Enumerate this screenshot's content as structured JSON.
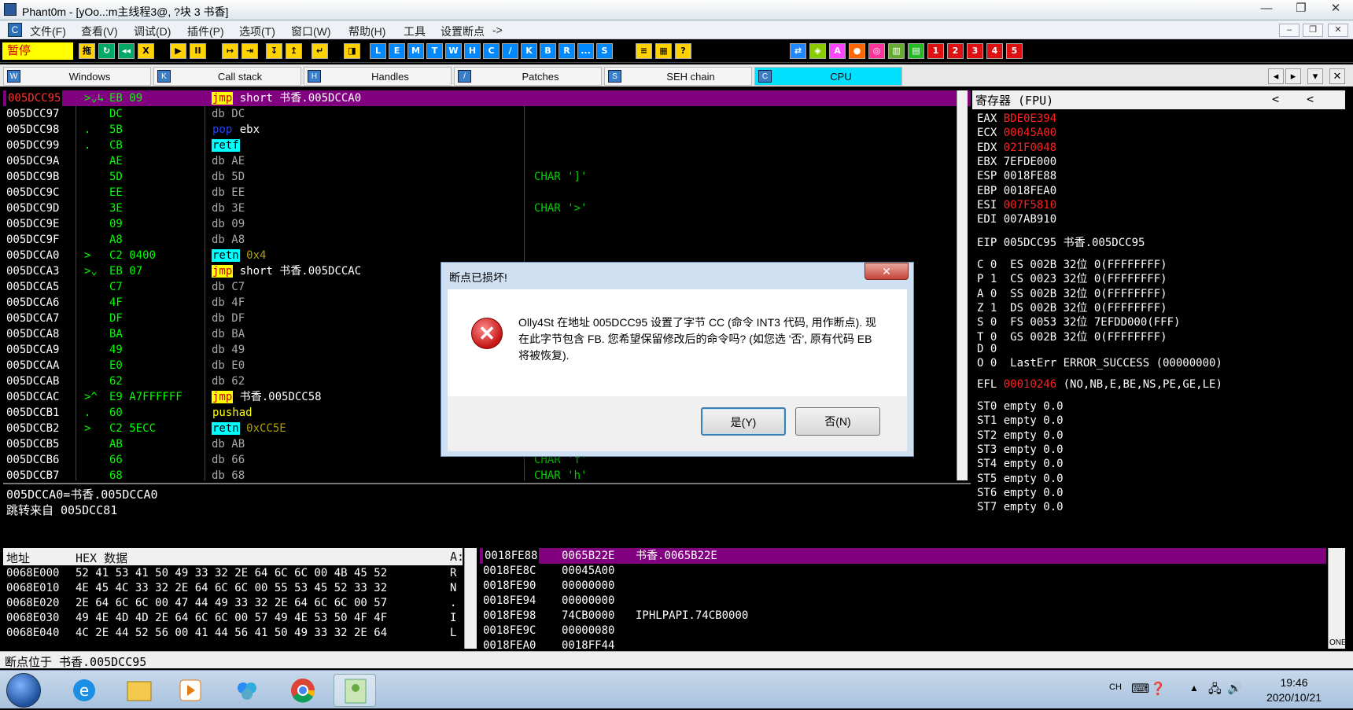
{
  "window": {
    "title": "Phant0m - [yOo..:m主线程3@, ?块 3 书香]",
    "min": "—",
    "max": "❐",
    "close": "✕"
  },
  "menu": {
    "items": [
      "文件(F)",
      "查看(V)",
      "调试(D)",
      "插件(P)",
      "选项(T)",
      "窗口(W)",
      "帮助(H)",
      "工具",
      "设置断点",
      "->"
    ],
    "mdi_min": "–",
    "mdi_restore": "❐",
    "mdi_close": "✕"
  },
  "toolbar": {
    "status": "暂停",
    "buttons": [
      "拖",
      "↻",
      "◂◂",
      "X",
      "▶",
      "II",
      "↦",
      "⇥",
      "↧",
      "↥",
      "↵",
      "◨"
    ],
    "letters": [
      "L",
      "E",
      "M",
      "T",
      "W",
      "H",
      "C",
      "/",
      "K",
      "B",
      "R",
      "...",
      "S"
    ],
    "buttons2": [
      "≡",
      "▦",
      "?"
    ],
    "right_buttons": [
      "⇄",
      "◈",
      "A",
      "●",
      "◎",
      "▥",
      "▤"
    ],
    "numbers": [
      "1",
      "2",
      "3",
      "4",
      "5"
    ]
  },
  "tabs": [
    {
      "icon": "W",
      "label": "Windows"
    },
    {
      "icon": "K",
      "label": "Call stack"
    },
    {
      "icon": "H",
      "label": "Handles"
    },
    {
      "icon": "/",
      "label": "Patches"
    },
    {
      "icon": "S",
      "label": "SEH chain"
    },
    {
      "icon": "C",
      "label": "CPU"
    }
  ],
  "tabnav": {
    "left": "◂",
    "right": "▸",
    "down": "▾",
    "close": "✕"
  },
  "cpu": {
    "rows": [
      {
        "addr": "005DCC95",
        "mark": ">⌄↳",
        "hex": "EB 09",
        "mn": "jmp",
        "ops": " short 书香.005DCCA0",
        "hl": "yellow",
        "cmt": ""
      },
      {
        "addr": "005DCC97",
        "mark": "",
        "hex": "DC",
        "mn": "",
        "ops": "db DC",
        "hl": "",
        "cmt": ""
      },
      {
        "addr": "005DCC98",
        "mark": ".",
        "hex": "5B",
        "mn": "pop",
        "ops": " ebx",
        "hl": "blue",
        "cmt": ""
      },
      {
        "addr": "005DCC99",
        "mark": ".",
        "hex": "CB",
        "mn": "retf",
        "ops": "",
        "hl": "cyan",
        "cmt": ""
      },
      {
        "addr": "005DCC9A",
        "mark": "",
        "hex": "AE",
        "mn": "",
        "ops": "db AE",
        "hl": "",
        "cmt": ""
      },
      {
        "addr": "005DCC9B",
        "mark": "",
        "hex": "5D",
        "mn": "",
        "ops": "db 5D",
        "hl": "",
        "cmt": "CHAR ']'"
      },
      {
        "addr": "005DCC9C",
        "mark": "",
        "hex": "EE",
        "mn": "",
        "ops": "db EE",
        "hl": "",
        "cmt": ""
      },
      {
        "addr": "005DCC9D",
        "mark": "",
        "hex": "3E",
        "mn": "",
        "ops": "db 3E",
        "hl": "",
        "cmt": "CHAR '>'"
      },
      {
        "addr": "005DCC9E",
        "mark": "",
        "hex": "09",
        "mn": "",
        "ops": "db 09",
        "hl": "",
        "cmt": ""
      },
      {
        "addr": "005DCC9F",
        "mark": "",
        "hex": "A8",
        "mn": "",
        "ops": "db A8",
        "hl": "",
        "cmt": ""
      },
      {
        "addr": "005DCCA0",
        "mark": ">",
        "hex": "C2 0400",
        "mn": "retn",
        "ops": " 0x4",
        "hl": "cyan",
        "cmt": ""
      },
      {
        "addr": "005DCCA3",
        "mark": ">⌄",
        "hex": "EB 07",
        "mn": "jmp",
        "ops": " short 书香.005DCCAC",
        "hl": "yellow",
        "cmt": ""
      },
      {
        "addr": "005DCCA5",
        "mark": "",
        "hex": "C7",
        "mn": "",
        "ops": "db C7",
        "hl": "",
        "cmt": ""
      },
      {
        "addr": "005DCCA6",
        "mark": "",
        "hex": "4F",
        "mn": "",
        "ops": "db 4F",
        "hl": "",
        "cmt": ""
      },
      {
        "addr": "005DCCA7",
        "mark": "",
        "hex": "DF",
        "mn": "",
        "ops": "db DF",
        "hl": "",
        "cmt": ""
      },
      {
        "addr": "005DCCA8",
        "mark": "",
        "hex": "BA",
        "mn": "",
        "ops": "db BA",
        "hl": "",
        "cmt": ""
      },
      {
        "addr": "005DCCA9",
        "mark": "",
        "hex": "49",
        "mn": "",
        "ops": "db 49",
        "hl": "",
        "cmt": ""
      },
      {
        "addr": "005DCCAA",
        "mark": "",
        "hex": "E0",
        "mn": "",
        "ops": "db E0",
        "hl": "",
        "cmt": ""
      },
      {
        "addr": "005DCCAB",
        "mark": "",
        "hex": "62",
        "mn": "",
        "ops": "db 62",
        "hl": "",
        "cmt": ""
      },
      {
        "addr": "005DCCAC",
        "mark": ">^",
        "hex": "E9 A7FFFFFF",
        "mn": "jmp",
        "ops": " 书香.005DCC58",
        "hl": "yellow",
        "cmt": ""
      },
      {
        "addr": "005DCCB1",
        "mark": ".",
        "hex": "60",
        "mn": "pushad",
        "ops": "",
        "hl": "yellowtext",
        "cmt": ""
      },
      {
        "addr": "005DCCB2",
        "mark": ">",
        "hex": "C2 5ECC",
        "mn": "retn",
        "ops": " 0xCC5E",
        "hl": "cyan",
        "cmt": ""
      },
      {
        "addr": "005DCCB5",
        "mark": "",
        "hex": "AB",
        "mn": "",
        "ops": "db AB",
        "hl": "",
        "cmt": ""
      },
      {
        "addr": "005DCCB6",
        "mark": "",
        "hex": "66",
        "mn": "",
        "ops": "db 66",
        "hl": "",
        "cmt": "CHAR 'f'"
      },
      {
        "addr": "005DCCB7",
        "mark": "",
        "hex": "68",
        "mn": "",
        "ops": "db 68",
        "hl": "",
        "cmt": "CHAR 'h'"
      }
    ]
  },
  "info": {
    "line1": "005DCCA0=书香.005DCCA0",
    "line2": "跳转来自 005DCC81"
  },
  "registers": {
    "header": "寄存器 (FPU)",
    "nav_left": "<",
    "nav_right": "<",
    "gp": [
      {
        "name": "EAX",
        "value": "BDE0E394",
        "changed": true
      },
      {
        "name": "ECX",
        "value": "00045A00",
        "changed": true
      },
      {
        "name": "EDX",
        "value": "021F0048",
        "changed": true
      },
      {
        "name": "EBX",
        "value": "7EFDE000",
        "changed": false
      },
      {
        "name": "ESP",
        "value": "0018FE88",
        "changed": false
      },
      {
        "name": "EBP",
        "value": "0018FEA0",
        "changed": false
      },
      {
        "name": "ESI",
        "value": "007F5810",
        "changed": true
      },
      {
        "name": "EDI",
        "value": "007AB910",
        "changed": false
      }
    ],
    "eip": "EIP 005DCC95 书香.005DCC95",
    "flags": [
      "C 0  ES 002B 32位 0(FFFFFFFF)",
      "P 1  CS 0023 32位 0(FFFFFFFF)",
      "A 0  SS 002B 32位 0(FFFFFFFF)",
      "Z 1  DS 002B 32位 0(FFFFFFFF)",
      "S 0  FS 0053 32位 7EFDD000(FFF)",
      "T 0  GS 002B 32位 0(FFFFFFFF)",
      "D 0",
      "O 0  LastErr ERROR_SUCCESS (00000000)"
    ],
    "efl_name": "EFL",
    "efl_value": "00010246",
    "efl_desc": " (NO,NB,E,BE,NS,PE,GE,LE)",
    "fpu": [
      "ST0 empty 0.0",
      "ST1 empty 0.0",
      "ST2 empty 0.0",
      "ST3 empty 0.0",
      "ST4 empty 0.0",
      "ST5 empty 0.0",
      "ST6 empty 0.0",
      "ST7 empty 0.0"
    ]
  },
  "dump": {
    "col_addr": "地址",
    "col_hex": "HEX 数据",
    "col_ascii": "A:",
    "rows": [
      {
        "addr": "0068E000",
        "hex": "52 41 53 41 50 49 33 32 2E 64 6C 6C 00 4B 45 52",
        "ascii": "R"
      },
      {
        "addr": "0068E010",
        "hex": "4E 45 4C 33 32 2E 64 6C 6C 00 55 53 45 52 33 32",
        "ascii": "N"
      },
      {
        "addr": "0068E020",
        "hex": "2E 64 6C 6C 00 47 44 49 33 32 2E 64 6C 6C 00 57",
        "ascii": "."
      },
      {
        "addr": "0068E030",
        "hex": "49 4E 4D 4D 2E 64 6C 6C 00 57 49 4E 53 50 4F 4F",
        "ascii": "I"
      },
      {
        "addr": "0068E040",
        "hex": "4C 2E 44 52 56 00 41 44 56 41 50 49 33 32 2E 64",
        "ascii": "L"
      }
    ]
  },
  "stack": {
    "rows": [
      {
        "addr": "0018FE88",
        "val": "0065B22E",
        "cmt": "书香.0065B22E"
      },
      {
        "addr": "0018FE8C",
        "val": "00045A00",
        "cmt": ""
      },
      {
        "addr": "0018FE90",
        "val": "00000000",
        "cmt": ""
      },
      {
        "addr": "0018FE94",
        "val": "00000000",
        "cmt": ""
      },
      {
        "addr": "0018FE98",
        "val": "74CB0000",
        "cmt": "IPHLPAPI.74CB0000"
      },
      {
        "addr": "0018FE9C",
        "val": "00000080",
        "cmt": ""
      },
      {
        "addr": "0018FEA0",
        "val": "0018FF44",
        "cmt": ""
      }
    ],
    "scroll_label": "ONE"
  },
  "status": "断点位于 书香.005DCC95",
  "dialog": {
    "title": "断点已损坏!",
    "close": "✕",
    "icon": "✕",
    "message": "Olly4St 在地址 005DCC95 设置了字节 CC (命令 INT3 代码, 用作断点). 现在此字节包含 FB. 您希望保留修改后的命令吗? (如您选 '否', 原有代码 EB 将被恢复).",
    "yes": "是(Y)",
    "no": "否(N)"
  },
  "taskbar": {
    "time": "19:46",
    "date": "2020/10/21",
    "lang": "CH"
  }
}
